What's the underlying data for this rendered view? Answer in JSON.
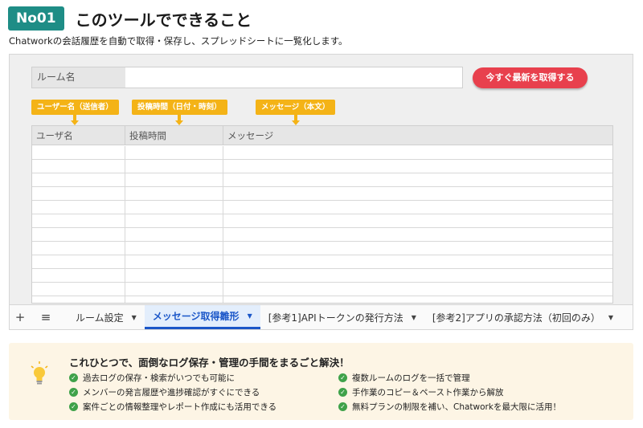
{
  "header": {
    "badge": "No01",
    "title": "このツールでできること",
    "subtitle": "Chatworkの会話履歴を自動で取得・保存し、スプレッドシートに一覧化します。"
  },
  "sheet": {
    "room_label": "ルーム名",
    "room_value": "",
    "fetch_button": "今すぐ最新を取得する",
    "callouts": [
      "ユーザー名（送信者）",
      "投稿時間（日付・時刻）",
      "メッセージ（本文）"
    ],
    "columns": [
      "ユーザ名",
      "投稿時間",
      "メッセージ"
    ]
  },
  "tabbar": {
    "add_icon": "+",
    "menu_icon": "≡",
    "tabs": [
      {
        "label": "ルーム設定",
        "active": false
      },
      {
        "label": "メッセージ取得雛形",
        "active": true
      },
      {
        "label": "[参考1]APIトークンの発行方法",
        "active": false
      },
      {
        "label": "[参考2]アプリの承認方法（初回のみ）",
        "active": false
      }
    ],
    "dropdown_icon": "▼"
  },
  "info": {
    "title": "これひとつで、面倒なログ保存・管理の手間をまるごと解決！",
    "check_icon": "✓",
    "features_left": [
      "過去ログの保存・検索がいつでも可能に",
      "メンバーの発言履歴や進捗確認がすぐにできる",
      "案件ごとの情報整理やレポート作成にも活用できる"
    ],
    "features_right": [
      "複数ルームのログを一括で管理",
      "手作業のコピー＆ペースト作業から解放",
      "無料プランの制限を補い、Chatworkを最大限に活用！"
    ]
  },
  "colors": {
    "badge": "#1e8d86",
    "fetch_button": "#e8404d",
    "callout": "#f4b317",
    "active_tab": "#1a56c8",
    "check": "#3fa24a",
    "info_bg": "#fdf5e5"
  }
}
